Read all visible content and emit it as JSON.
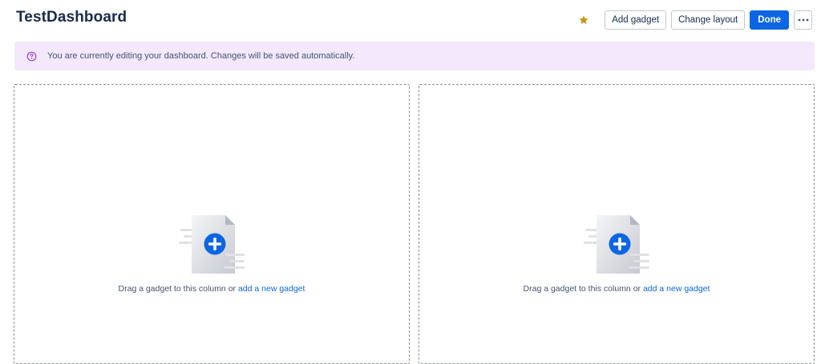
{
  "header": {
    "title": "TestDashboard",
    "star_icon": "star-icon",
    "star_color": "#c9961a",
    "add_gadget_label": "Add gadget",
    "change_layout_label": "Change layout",
    "done_label": "Done",
    "more_icon": "more-horizontal-icon"
  },
  "banner": {
    "icon": "question-circle-icon",
    "text": "You are currently editing your dashboard. Changes will be saved automatically.",
    "background": "#f3e8fc",
    "icon_color": "#a54bd7"
  },
  "columns": [
    {
      "illustration": "add-gadget-illustration",
      "text": "Drag a gadget to this column or",
      "link": "add a new gadget"
    },
    {
      "illustration": "add-gadget-illustration",
      "text": "Drag a gadget to this column or",
      "link": "add a new gadget"
    }
  ],
  "colors": {
    "primary": "#0c66e4",
    "text": "#172b4d",
    "subtle_text": "#44546f"
  }
}
